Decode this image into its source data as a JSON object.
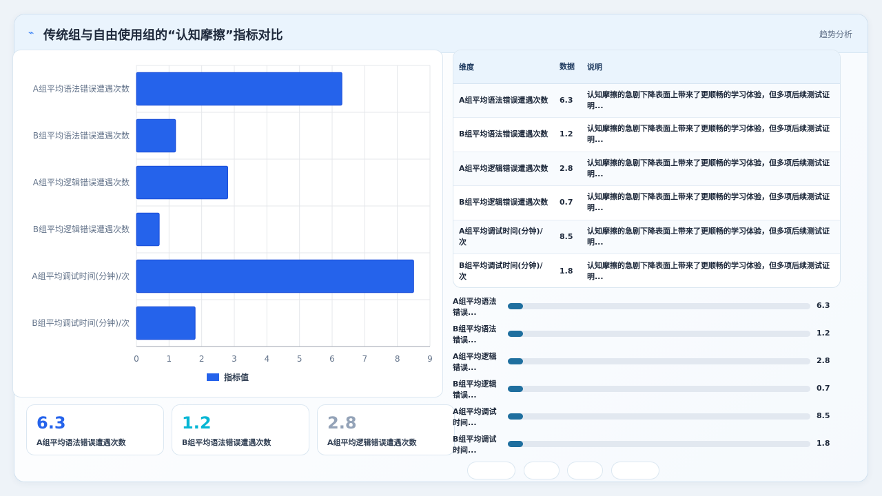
{
  "header": {
    "title": "传统组与自由使用组的“认知摩擦”指标对比",
    "trend_label": "趋势分析",
    "logo_icon": "spark-icon"
  },
  "chart_data": {
    "type": "bar",
    "orientation": "horizontal",
    "categories": [
      "A组平均语法错误遭遇次数",
      "B组平均语法错误遭遇次数",
      "A组平均逻辑错误遭遇次数",
      "B组平均逻辑错误遭遇次数",
      "A组平均调试时间(分钟)/次",
      "B组平均调试时间(分钟)/次"
    ],
    "series": [
      {
        "name": "指标值",
        "values": [
          6.3,
          1.2,
          2.8,
          0.7,
          8.5,
          1.8
        ]
      }
    ],
    "xlim": [
      0,
      9
    ],
    "xticks": [
      0,
      1,
      2,
      3,
      4,
      5,
      6,
      7,
      8,
      9
    ],
    "grid": true,
    "legend": "bottom",
    "color": "#2563eb"
  },
  "stats": [
    {
      "value": "6.3",
      "label": "A组平均语法错误遭遇次数",
      "color": "#2563eb"
    },
    {
      "value": "1.2",
      "label": "B组平均语法错误遭遇次数",
      "color": "#06b6d4"
    },
    {
      "value": "2.8",
      "label": "A组平均逻辑错误遭遇次数",
      "color": "#94a3b8"
    }
  ],
  "table": {
    "headers": [
      "维度",
      "数据",
      "说明"
    ],
    "rows": [
      {
        "dim": "A组平均语法错误遭遇次数",
        "value": "6.3",
        "desc": "认知摩擦的急剧下降表面上带来了更顺畅的学习体验，但多项后续测试证明..."
      },
      {
        "dim": "B组平均语法错误遭遇次数",
        "value": "1.2",
        "desc": "认知摩擦的急剧下降表面上带来了更顺畅的学习体验，但多项后续测试证明..."
      },
      {
        "dim": "A组平均逻辑错误遭遇次数",
        "value": "2.8",
        "desc": "认知摩擦的急剧下降表面上带来了更顺畅的学习体验，但多项后续测试证明..."
      },
      {
        "dim": "B组平均逻辑错误遭遇次数",
        "value": "0.7",
        "desc": "认知摩擦的急剧下降表面上带来了更顺畅的学习体验，但多项后续测试证明..."
      },
      {
        "dim": "A组平均调试时间(分钟)/次",
        "value": "8.5",
        "desc": "认知摩擦的急剧下降表面上带来了更顺畅的学习体验，但多项后续测试证明..."
      },
      {
        "dim": "B组平均调试时间(分钟)/次",
        "value": "1.8",
        "desc": "认知摩擦的急剧下降表面上带来了更顺畅的学习体验，但多项后续测试证明..."
      }
    ]
  },
  "progress": [
    {
      "label": "A组平均语法错误...",
      "value": "6.3",
      "fraction": 0.05
    },
    {
      "label": "B组平均语法错误...",
      "value": "1.2",
      "fraction": 0.05
    },
    {
      "label": "A组平均逻辑错误...",
      "value": "2.8",
      "fraction": 0.05
    },
    {
      "label": "B组平均逻辑错误...",
      "value": "0.7",
      "fraction": 0.05
    },
    {
      "label": "A组平均调试时间...",
      "value": "8.5",
      "fraction": 0.05
    },
    {
      "label": "B组平均调试时间...",
      "value": "1.8",
      "fraction": 0.05
    }
  ]
}
